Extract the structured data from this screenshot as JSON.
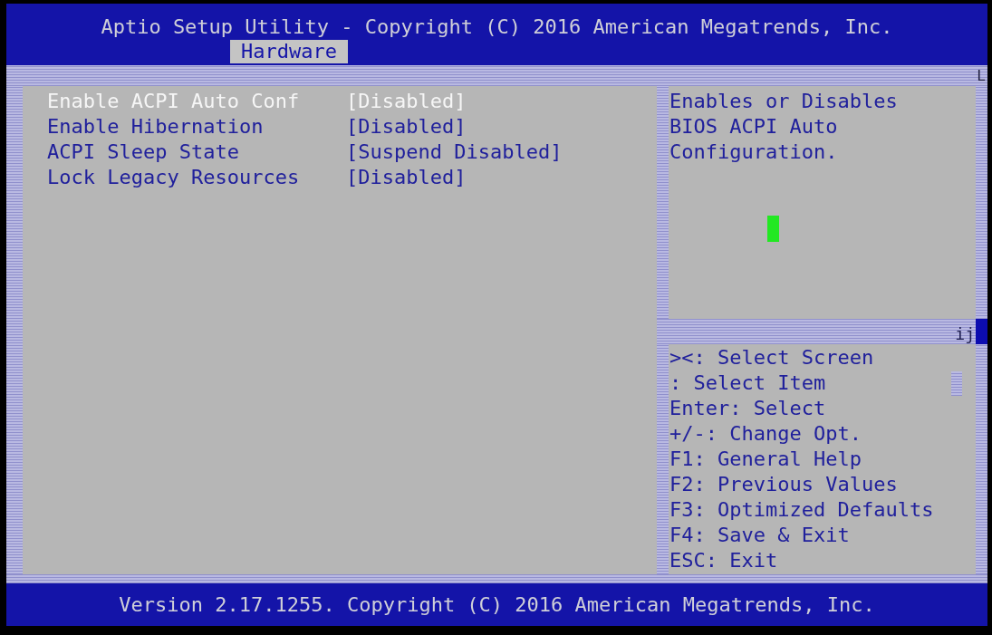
{
  "header": {
    "title": "Aptio Setup Utility - Copyright (C) 2016 American Megatrends, Inc.",
    "tabs": [
      {
        "label": "Hardware",
        "selected": true
      }
    ]
  },
  "frame_glyphs": {
    "top_right": "L",
    "divider_right": "ij"
  },
  "settings": [
    {
      "label": "Enable ACPI Auto Conf",
      "value": "[Disabled]",
      "selected": true
    },
    {
      "label": "Enable Hibernation",
      "value": "[Disabled]",
      "selected": false
    },
    {
      "label": "ACPI Sleep State",
      "value": "[Suspend Disabled]",
      "selected": false
    },
    {
      "label": "Lock Legacy Resources",
      "value": "[Disabled]",
      "selected": false
    }
  ],
  "help": {
    "text": "Enables or Disables BIOS ACPI Auto Configuration."
  },
  "key_help": [
    "><: Select Screen",
    ": Select Item",
    "Enter: Select",
    "+/-: Change Opt.",
    "F1: General Help",
    "F2: Previous Values",
    "F3: Optimized Defaults",
    "F4: Save & Exit",
    "ESC: Exit"
  ],
  "footer": {
    "text": "Version 2.17.1255. Copyright (C) 2016 American Megatrends, Inc."
  }
}
